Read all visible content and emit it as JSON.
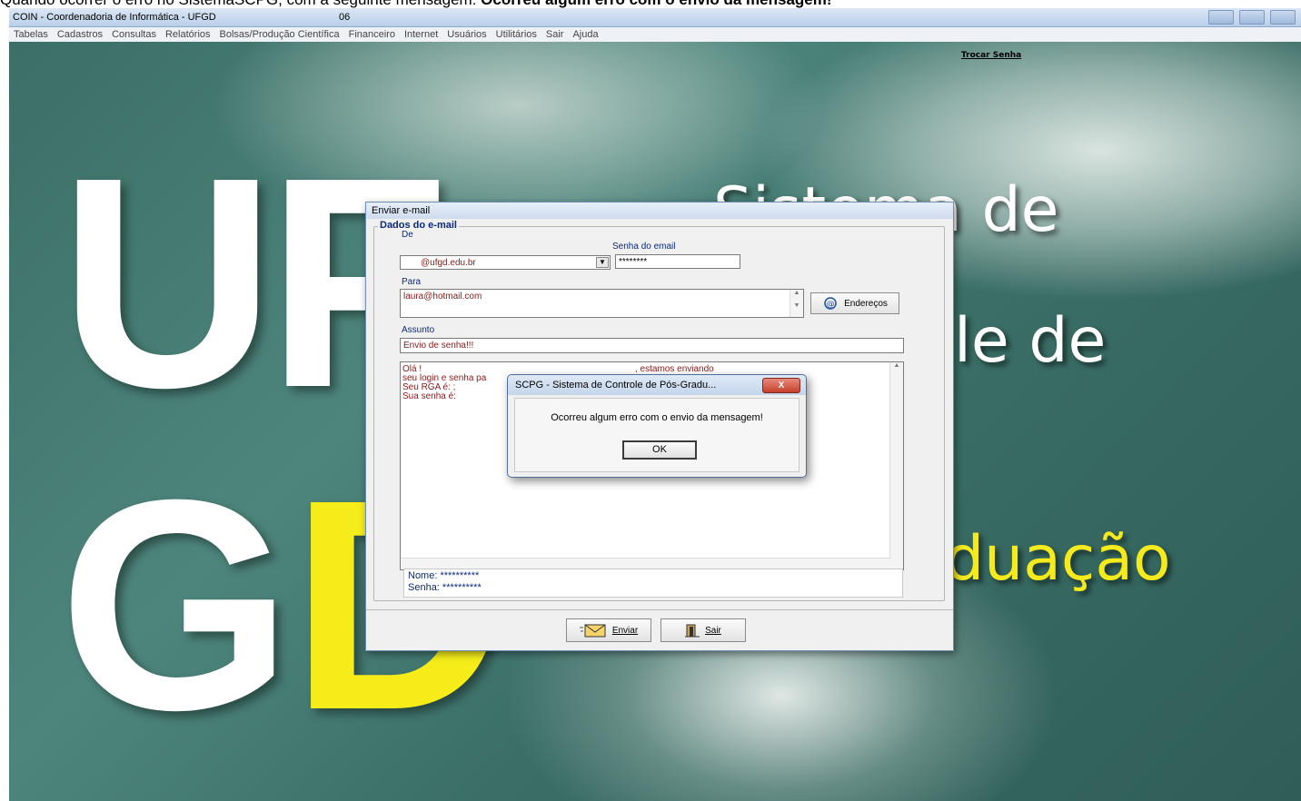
{
  "caption": {
    "prefix": "Quando ocorrer o erro no SistemaSCPG, com a seguinte mensagem: ",
    "bold": "Ocorreu algum erro com o envio da mensagem!"
  },
  "app": {
    "title": "COIN - Coordenadoria de Informática - UFGD",
    "title_num": "06",
    "trocar_senha": "Trocar Senha"
  },
  "menu": [
    "Tabelas",
    "Cadastros",
    "Consultas",
    "Relatórios",
    "Bolsas/Produção Científica",
    "Financeiro",
    "Internet",
    "Usuários",
    "Utilitários",
    "Sair",
    "Ajuda"
  ],
  "background": {
    "big_u": "UF",
    "big_g": "G",
    "big_d": "D",
    "line1": "Sistema de",
    "line2": "le de",
    "line3": "duação"
  },
  "email_window": {
    "title": "Enviar e-mail",
    "group_title": "Dados do e-mail",
    "de_label": "De",
    "de_value": "@ufgd.edu.br",
    "senha_label": "Senha do email",
    "senha_value": "********",
    "para_label": "Para",
    "para_value": "laura@hotmail.com",
    "enderecos_button": "Endereços",
    "assunto_label": "Assunto",
    "assunto_value": "Envio de senha!!!",
    "body_lines": [
      "Olá !",
      " seu login e senha pa",
      "Seu RGA é: ;",
      "Sua senha é:"
    ],
    "body_line1_tail": ", estamos enviando",
    "nome_line": "Nome: **********",
    "senha_line": "Senha: **********",
    "enviar_button": "Enviar",
    "sair_button": "Sair"
  },
  "message_box": {
    "title": "SCPG - Sistema de Controle de Pós-Gradu...",
    "text": "Ocorreu algum erro com o envio da mensagem!",
    "ok_button": "OK",
    "close": "X"
  }
}
